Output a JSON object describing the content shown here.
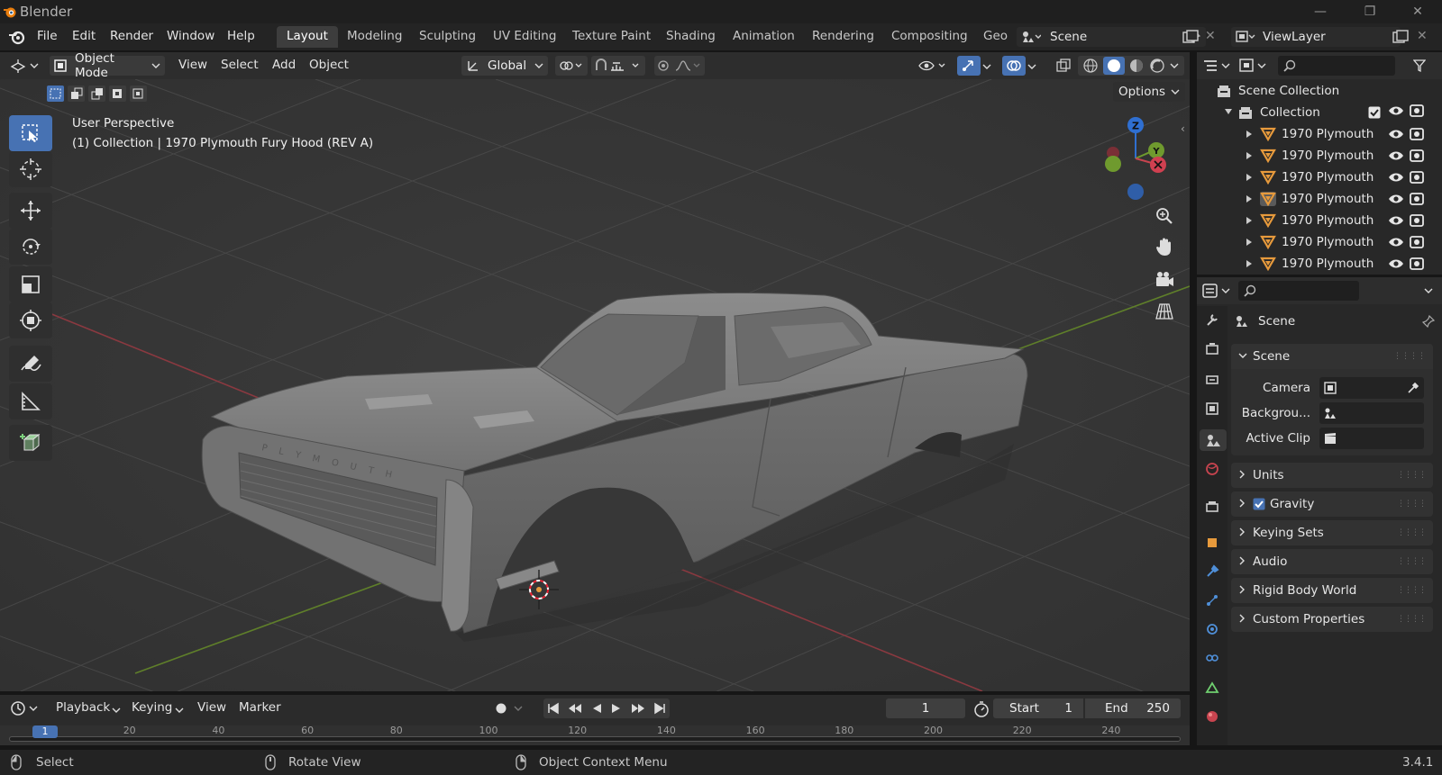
{
  "app": {
    "title": "Blender",
    "version": "3.4.1"
  },
  "menus": [
    "File",
    "Edit",
    "Render",
    "Window",
    "Help"
  ],
  "workspaces": [
    "Layout",
    "Modeling",
    "Sculpting",
    "UV Editing",
    "Texture Paint",
    "Shading",
    "Animation",
    "Rendering",
    "Compositing",
    "Geo"
  ],
  "scene_field": "Scene",
  "viewlayer_field": "ViewLayer",
  "viewport_header": {
    "mode": "Object Mode",
    "menus": [
      "View",
      "Select",
      "Add",
      "Object"
    ],
    "orientation": "Global",
    "options": "Options"
  },
  "viewport": {
    "perspective": "User Perspective",
    "object_info": "(1) Collection | 1970 Plymouth Fury Hood (REV A)",
    "gizmo_z": "Z",
    "hood_text": "P L Y M O U T H"
  },
  "outliner": {
    "root": "Scene Collection",
    "collection": "Collection",
    "items": [
      "1970 Plymouth",
      "1970 Plymouth",
      "1970 Plymouth",
      "1970 Plymouth",
      "1970 Plymouth",
      "1970 Plymouth",
      "1970 Plymouth"
    ]
  },
  "properties": {
    "header": "Scene",
    "section": "Scene",
    "camera_label": "Camera",
    "background_label": "Backgrou...",
    "active_clip_label": "Active Clip",
    "panels": [
      "Units",
      "Gravity",
      "Keying Sets",
      "Audio",
      "Rigid Body World",
      "Custom Properties"
    ]
  },
  "timeline": {
    "menus": [
      "Playback",
      "Keying",
      "View",
      "Marker"
    ],
    "current_frame": "1",
    "start_label": "Start",
    "start_value": "1",
    "end_label": "End",
    "end_value": "250",
    "ruler": [
      "1",
      "20",
      "40",
      "60",
      "80",
      "100",
      "120",
      "140",
      "160",
      "180",
      "200",
      "220",
      "240"
    ]
  },
  "statusbar": {
    "select": "Select",
    "rotate": "Rotate View",
    "context": "Object Context Menu"
  },
  "colors": {
    "accent": "#4772b3",
    "orange": "#e79a3c",
    "x_axis": "#c8444f",
    "y_axis": "#6f9a2e",
    "z_axis": "#2f6fd1"
  }
}
